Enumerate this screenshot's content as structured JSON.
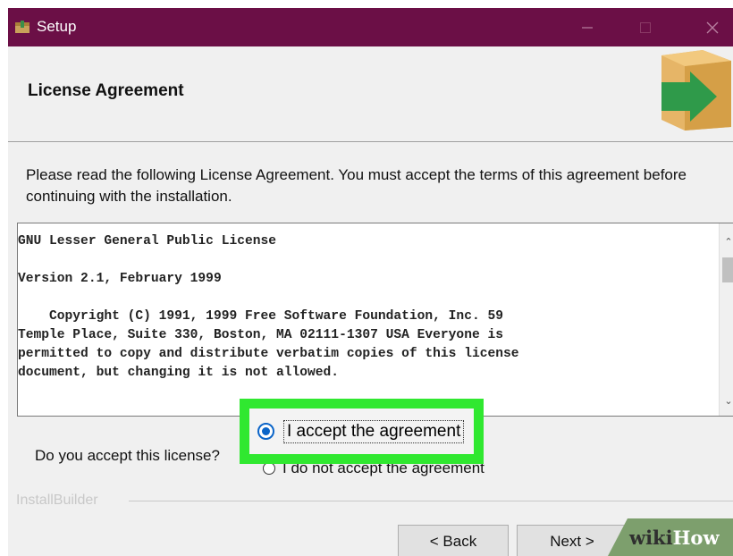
{
  "window": {
    "title": "Setup",
    "accent_color": "#6b0f46",
    "controls": [
      "minimize-icon",
      "maximize-icon",
      "close-icon"
    ]
  },
  "header": {
    "title": "License Agreement",
    "logo_icon": "box-arrow-icon"
  },
  "intro_text": "Please read the following License Agreement. You must accept the terms of this agreement before continuing with the installation.",
  "license": {
    "text": "GNU Lesser General Public License\n\nVersion 2.1, February 1999\n\n    Copyright (C) 1991, 1999 Free Software Foundation, Inc. 59\nTemple Place, Suite 330, Boston, MA 02111-1307 USA Everyone is\npermitted to copy and distribute verbatim copies of this license\ndocument, but changing it is not allowed."
  },
  "question": "Do you accept this license?",
  "options": {
    "accept": "I accept the agreement",
    "decline": "I do not accept the agreement",
    "selected": "accept"
  },
  "footer": {
    "group_label": "InstallBuilder",
    "back_label": "< Back",
    "next_label": "Next >"
  },
  "watermark": {
    "wiki": "wiki",
    "how": "How"
  },
  "colors": {
    "highlight": "#30e830",
    "radio_selected": "#0a64c8"
  }
}
